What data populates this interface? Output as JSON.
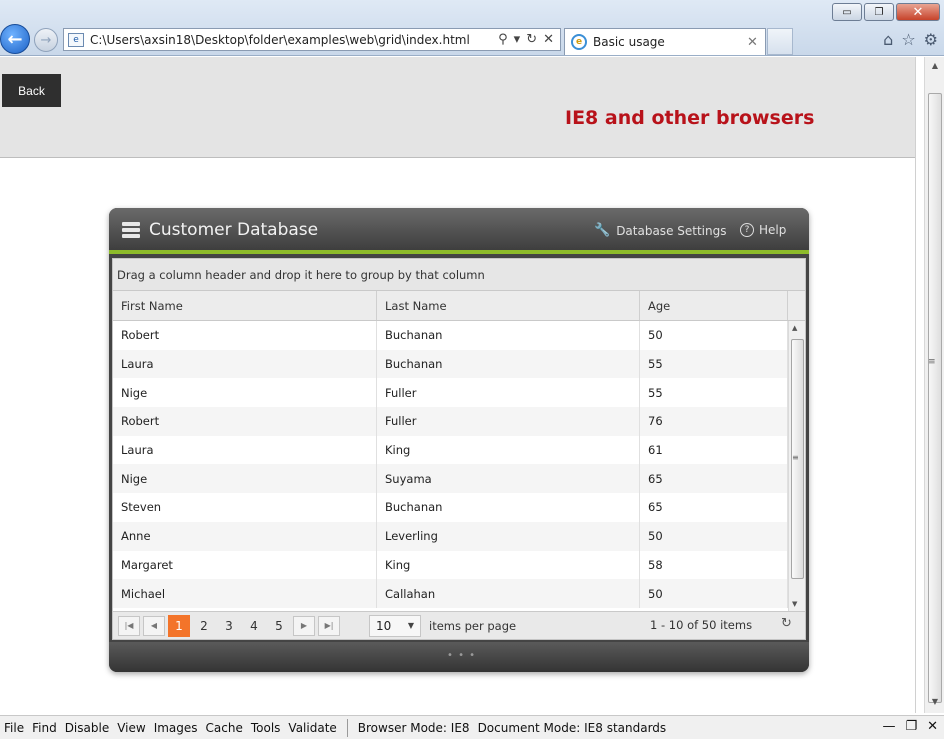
{
  "browser": {
    "address": "C:\\Users\\axsin18\\Desktop\\folder\\examples\\web\\grid\\index.html",
    "tab_title": "Basic usage",
    "window_controls": {
      "minimize": "▭",
      "restore": "❐",
      "close": "✕"
    }
  },
  "page": {
    "back_label": "Back",
    "header_title": "IE8 and other browsers",
    "title_color": "#b8121a"
  },
  "widget": {
    "title": "Customer Database",
    "settings_label": "Database Settings",
    "help_label": "Help",
    "accent_color": "#8dbb2a",
    "group_hint": "Drag a column header and drop it here to group by that column",
    "columns": [
      "First Name",
      "Last Name",
      "Age"
    ],
    "rows": [
      [
        "Robert",
        "Buchanan",
        "50"
      ],
      [
        "Laura",
        "Buchanan",
        "55"
      ],
      [
        "Nige",
        "Fuller",
        "55"
      ],
      [
        "Robert",
        "Fuller",
        "76"
      ],
      [
        "Laura",
        "King",
        "61"
      ],
      [
        "Nige",
        "Suyama",
        "65"
      ],
      [
        "Steven",
        "Buchanan",
        "65"
      ],
      [
        "Anne",
        "Leverling",
        "50"
      ],
      [
        "Margaret",
        "King",
        "58"
      ],
      [
        "Michael",
        "Callahan",
        "50"
      ]
    ],
    "pager": {
      "pages": [
        "1",
        "2",
        "3",
        "4",
        "5"
      ],
      "active_page": "1",
      "page_size": "10",
      "page_size_label": "items per page",
      "info": "1 - 10 of 50 items",
      "active_color": "#f3742a"
    }
  },
  "devbar": {
    "menu": [
      "File",
      "Find",
      "Disable",
      "View",
      "Images",
      "Cache",
      "Tools",
      "Validate"
    ],
    "browser_mode_label": "Browser Mode:",
    "browser_mode": "IE8",
    "document_mode_label": "Document Mode:",
    "document_mode": "IE8 standards"
  }
}
